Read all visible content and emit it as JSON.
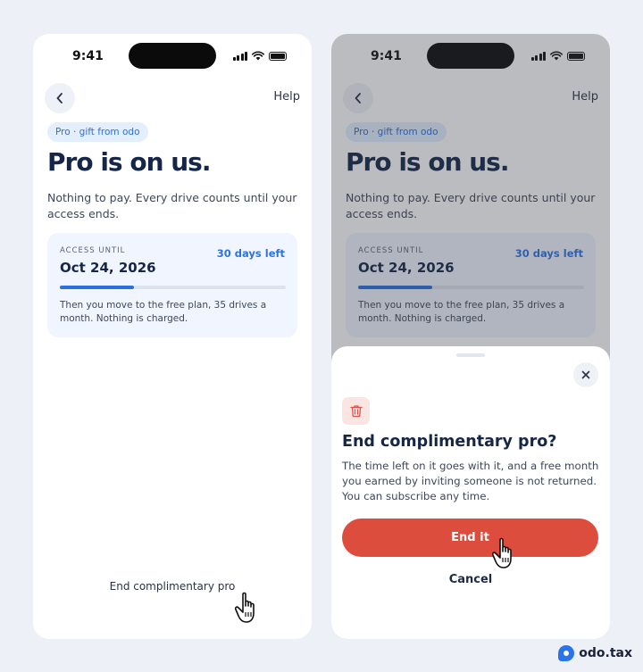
{
  "status_bar": {
    "time": "9:41"
  },
  "header": {
    "help_label": "Help"
  },
  "screen": {
    "chip_label": "Pro · gift from odo",
    "headline": "Pro is on us.",
    "subtext": "Nothing to pay. Every drive counts until your access ends.",
    "access_card": {
      "label": "ACCESS UNTIL",
      "date": "Oct 24, 2026",
      "days_left": "30 days left",
      "progress_fraction": 0.33,
      "note": "Then you move to the free plan, 35 drives a month. Nothing is charged."
    },
    "end_link_label": "End complimentary pro"
  },
  "sheet": {
    "title": "End complimentary pro?",
    "body": "The time left on it goes with it, and a free month you earned by inviting someone is not returned. You can subscribe any time.",
    "confirm_label": "End it",
    "cancel_label": "Cancel"
  },
  "brand": {
    "name": "odo.tax"
  },
  "colors": {
    "accent": "#2b6fe0",
    "danger": "#dd4d3e",
    "background": "#eef0f7",
    "card": "#f0f5ff"
  },
  "icons": [
    "chevron-left-icon",
    "close-icon",
    "trash-icon",
    "hand-cursor-icon",
    "signal-icon",
    "wifi-icon",
    "battery-icon",
    "odo-logo-icon"
  ]
}
